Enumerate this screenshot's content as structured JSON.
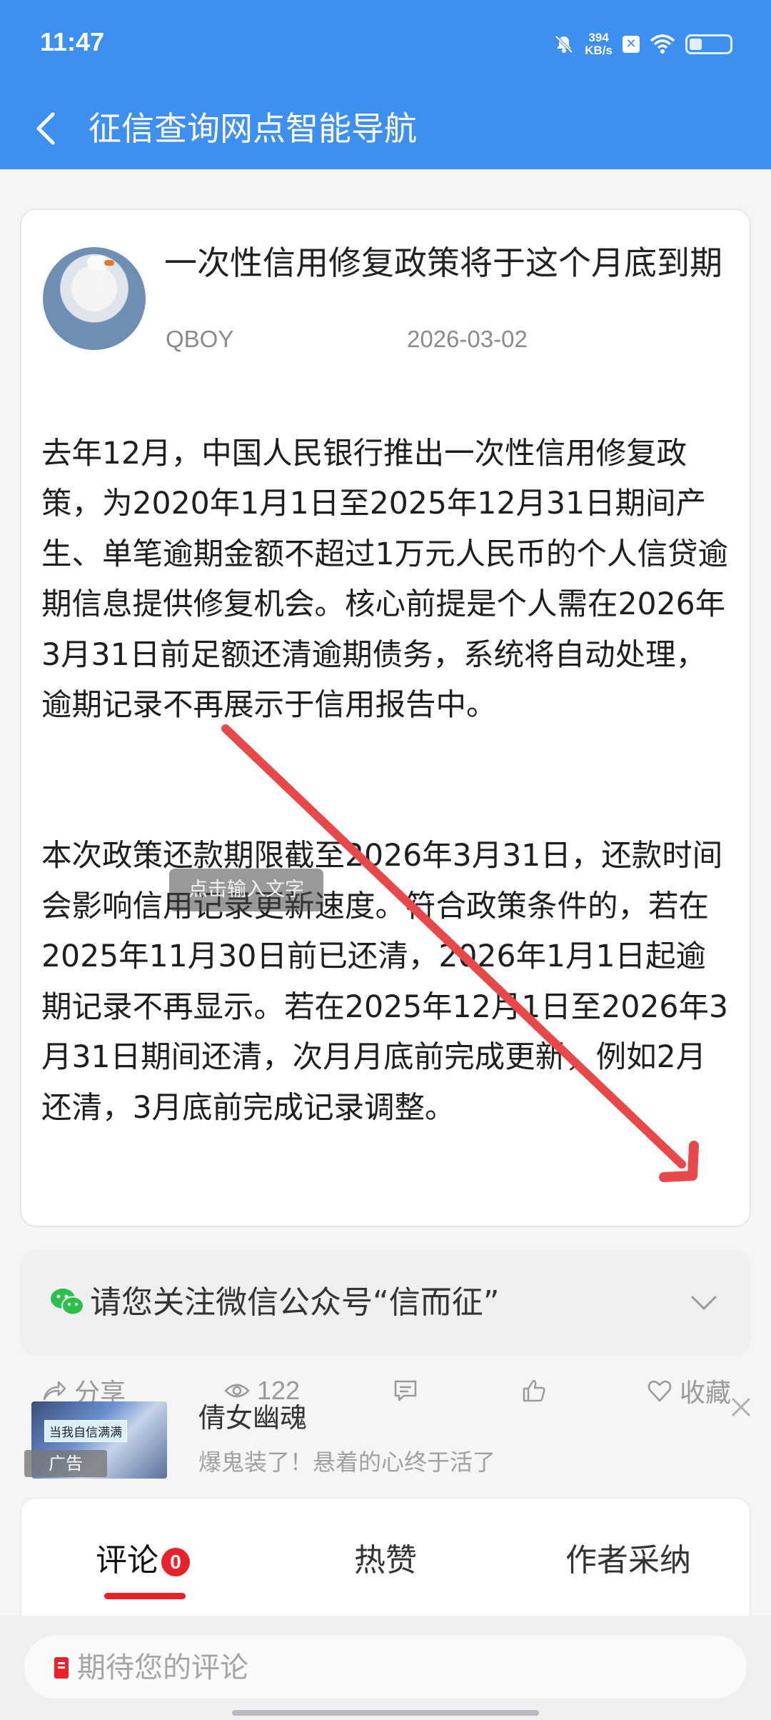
{
  "status_bar": {
    "time": "11:47",
    "net_speed_value": "394",
    "net_speed_unit": "KB/s",
    "icons": [
      "mute-bell-icon",
      "x-app-icon",
      "wifi-icon",
      "battery-icon"
    ],
    "battery_level": 0.3
  },
  "appbar": {
    "back_icon": "chevron-left-icon",
    "title": "征信查询网点智能导航"
  },
  "post": {
    "title": "一次性信用修复政策将于这个月底到期",
    "author": "QBOY",
    "date": "2026-03-02",
    "paragraphs": [
      "去年12月，中国人民银行推出一次性信用修复政策，为2020年1月1日至2025年12月31日期间产生、单笔逾期金额不超过1万元人民币的个人信贷逾期信息提供修复机会。核心前提是个人需在2026年3月31日前足额还清逾期债务，系统将自动处理，逾期记录不再展示于信用报告中。",
      "本次政策还款期限截至2026年3月31日，还款时间会影响信用记录更新速度。符合政策条件的，若在2025年11月30日前已还清，2026年1月1日起逾期记录不再显示。若在2025年12月1日至2026年3月31日期间还清，次月月底前完成更新，例如2月还清，3月底前完成记录调整。"
    ],
    "tooltip": "点击输入文字",
    "actions": {
      "share_label": "分享",
      "views": "122",
      "collect_label": "收藏"
    }
  },
  "wechat_banner": {
    "text": "请您关注微信公众号“信而征”"
  },
  "ad": {
    "thumb_caption": "当我自信满满",
    "badge": "广告",
    "title": "倩女幽魂",
    "subtitle": "爆鬼装了！悬着的心终于活了"
  },
  "tabs": [
    {
      "label": "评论",
      "count": "0"
    },
    {
      "label": "热赞"
    },
    {
      "label": "作者采纳"
    }
  ],
  "comment": {
    "placeholder": "期待您的评论"
  },
  "colors": {
    "primary": "#3d8ff0",
    "accent_red": "#e8212a",
    "annotation_arrow": "#e8484a"
  }
}
